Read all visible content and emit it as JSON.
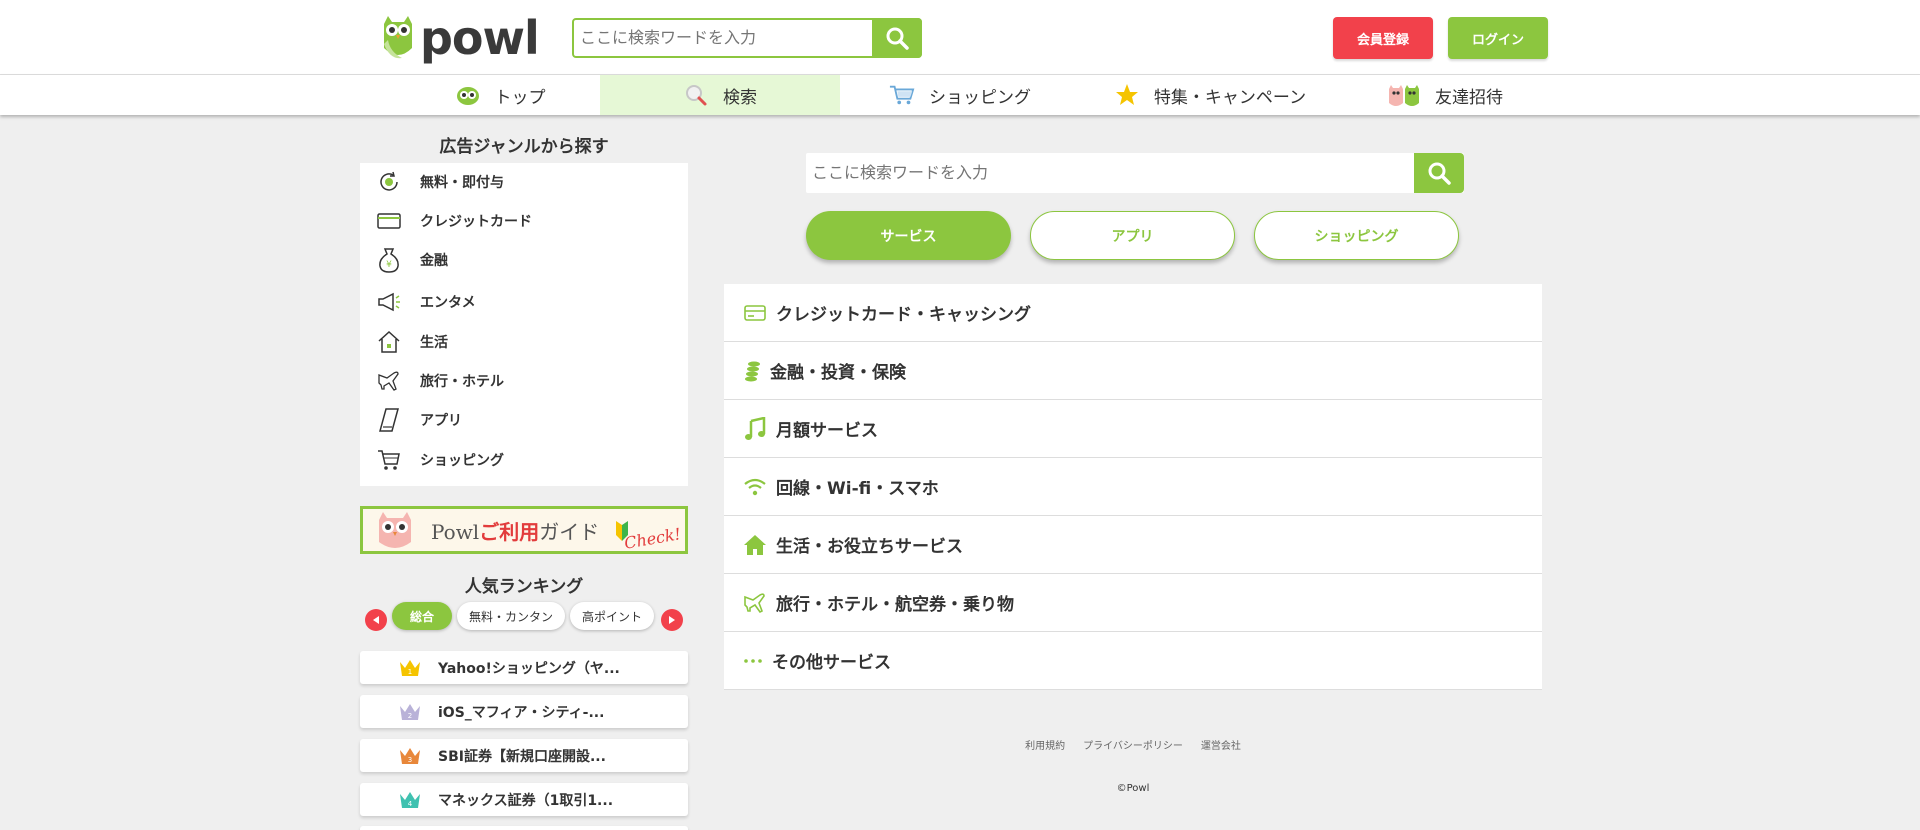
{
  "header": {
    "logo_text": "powl",
    "search_placeholder": "ここに検索ワードを入力",
    "register_label": "会員登録",
    "login_label": "ログイン"
  },
  "nav": {
    "items": [
      {
        "label": "トップ",
        "icon": "owl-face-icon"
      },
      {
        "label": "検索",
        "icon": "magnifier-icon",
        "active": true
      },
      {
        "label": "ショッピング",
        "icon": "cart-icon"
      },
      {
        "label": "特集・キャンペーン",
        "icon": "star-icon"
      },
      {
        "label": "友達招待",
        "icon": "owl-friends-icon"
      }
    ]
  },
  "sidebar": {
    "genre_title": "広告ジャンルから探す",
    "genres": [
      {
        "label": "無料・即付与",
        "icon": "coin-refresh-icon"
      },
      {
        "label": "クレジットカード",
        "icon": "credit-card-icon"
      },
      {
        "label": "金融",
        "icon": "money-bag-icon"
      },
      {
        "label": "エンタメ",
        "icon": "megaphone-icon"
      },
      {
        "label": "生活",
        "icon": "house-icon"
      },
      {
        "label": "旅行・ホテル",
        "icon": "airplane-icon"
      },
      {
        "label": "アプリ",
        "icon": "smartphone-icon"
      },
      {
        "label": "ショッピング",
        "icon": "cart-icon"
      }
    ],
    "guide": {
      "pre": "Powl",
      "highlight": "ご利用",
      "post": "ガイド",
      "check": "Check!"
    },
    "ranking_title": "人気ランキング",
    "ranking_tabs": [
      {
        "label": "総合",
        "active": true
      },
      {
        "label": "無料・カンタン"
      },
      {
        "label": "高ポイント"
      }
    ],
    "ranking_items": [
      {
        "rank": "1",
        "label": "Yahoo!ショッピング（ヤ...",
        "color": "#f5c400"
      },
      {
        "rank": "2",
        "label": "iOS_マフィア・シティ-...",
        "color": "#b9b2d8"
      },
      {
        "rank": "3",
        "label": "SBI証券【新規口座開設...",
        "color": "#e8873a"
      },
      {
        "rank": "4",
        "label": "マネックス証券（1取引1...",
        "color": "#3fc1b0"
      }
    ]
  },
  "main": {
    "search_placeholder": "ここに検索ワードを入力",
    "category_buttons": [
      {
        "label": "サービス",
        "active": true
      },
      {
        "label": "アプリ"
      },
      {
        "label": "ショッピング"
      }
    ],
    "services": [
      {
        "label": "クレジットカード・キャッシング",
        "icon": "credit-card-icon"
      },
      {
        "label": "金融・投資・保険",
        "icon": "coins-stack-icon"
      },
      {
        "label": "月額サービス",
        "icon": "music-note-icon"
      },
      {
        "label": "回線・Wi-fi・スマホ",
        "icon": "wifi-icon"
      },
      {
        "label": "生活・お役立ちサービス",
        "icon": "house-icon"
      },
      {
        "label": "旅行・ホテル・航空券・乗り物",
        "icon": "airplane-icon"
      },
      {
        "label": "その他サービス",
        "icon": "dots-icon"
      }
    ]
  },
  "footer": {
    "links": [
      "利用規約",
      "プライバシーポリシー",
      "運営会社"
    ],
    "copyright": "©Powl"
  },
  "colors": {
    "brand_green": "#8cc63f",
    "accent_red": "#f2414b",
    "nav_active_bg": "#e6f8d6",
    "page_bg": "#efefef"
  }
}
